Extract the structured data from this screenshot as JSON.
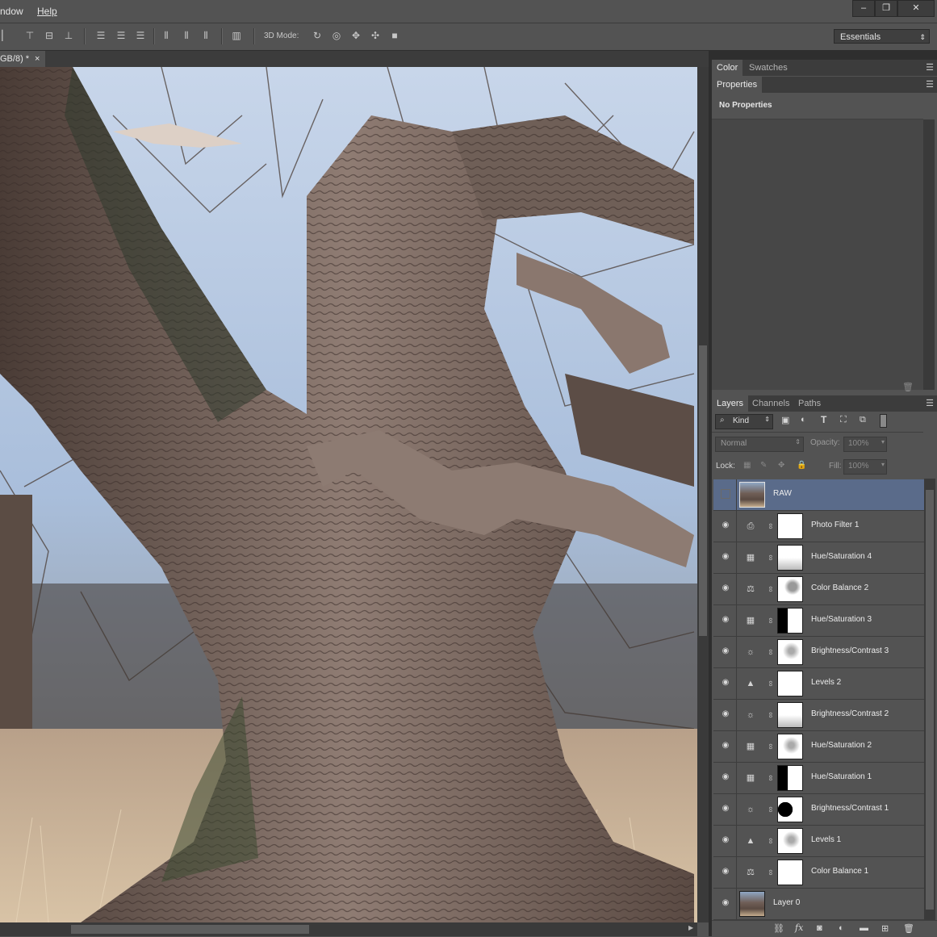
{
  "menubar": {
    "items": [
      "ndow",
      "Help"
    ],
    "window_buttons": [
      "–",
      "❐",
      "✕"
    ]
  },
  "optionsbar": {
    "mode_label": "3D Mode:",
    "workspace": "Essentials"
  },
  "document": {
    "tab_title": "GB/8) *",
    "tab_close": "×"
  },
  "color_panel": {
    "tabs": [
      "Color",
      "Swatches"
    ]
  },
  "properties_panel": {
    "tab": "Properties",
    "message": "No Properties"
  },
  "layers_panel": {
    "tabs": [
      "Layers",
      "Channels",
      "Paths"
    ],
    "filter_kind": "Kind",
    "blend_mode": "Normal",
    "opacity_label": "Opacity:",
    "opacity_value": "100%",
    "lock_label": "Lock:",
    "fill_label": "Fill:",
    "fill_value": "100%",
    "layers": [
      {
        "name": "RAW",
        "kind": "image",
        "selected": true,
        "visible": false
      },
      {
        "name": "Photo Filter 1",
        "kind": "photo-filter",
        "selected": false,
        "visible": true
      },
      {
        "name": "Hue/Saturation 4",
        "kind": "hue-saturation",
        "selected": false,
        "visible": true
      },
      {
        "name": "Color Balance 2",
        "kind": "color-balance",
        "selected": false,
        "visible": true
      },
      {
        "name": "Hue/Saturation 3",
        "kind": "hue-saturation",
        "selected": false,
        "visible": true
      },
      {
        "name": "Brightness/Contrast 3",
        "kind": "brightness-contrast",
        "selected": false,
        "visible": true
      },
      {
        "name": "Levels 2",
        "kind": "levels",
        "selected": false,
        "visible": true
      },
      {
        "name": "Brightness/Contrast 2",
        "kind": "brightness-contrast",
        "selected": false,
        "visible": true
      },
      {
        "name": "Hue/Saturation 2",
        "kind": "hue-saturation",
        "selected": false,
        "visible": true
      },
      {
        "name": "Hue/Saturation 1",
        "kind": "hue-saturation",
        "selected": false,
        "visible": true
      },
      {
        "name": "Brightness/Contrast 1",
        "kind": "brightness-contrast",
        "selected": false,
        "visible": true
      },
      {
        "name": "Levels 1",
        "kind": "levels",
        "selected": false,
        "visible": true
      },
      {
        "name": "Color Balance 1",
        "kind": "color-balance",
        "selected": false,
        "visible": true
      },
      {
        "name": "Layer 0",
        "kind": "image",
        "selected": false,
        "visible": true
      }
    ],
    "footer_icons": [
      "link-icon",
      "fx-icon",
      "add-mask-icon",
      "new-adjustment-icon",
      "new-group-icon",
      "new-layer-icon",
      "delete-icon"
    ]
  },
  "colors": {
    "chrome": "#535353",
    "dark": "#3c3c3c",
    "selection": "#5a6b8a"
  }
}
